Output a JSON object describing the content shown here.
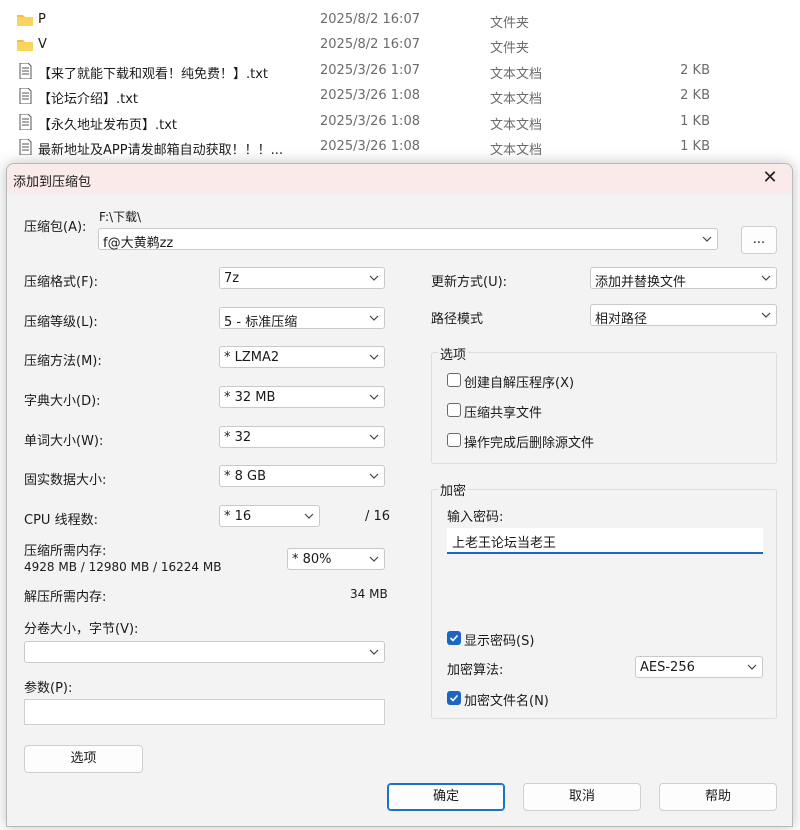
{
  "explorer": {
    "rows": [
      {
        "icon": "folder-icon",
        "name": "P",
        "date": "2025/8/2 16:07",
        "type": "文件夹",
        "size": ""
      },
      {
        "icon": "folder-icon",
        "name": "V",
        "date": "2025/8/2 16:07",
        "type": "文件夹",
        "size": ""
      },
      {
        "icon": "text-file-icon",
        "name": "【来了就能下载和观看！纯免费！】.txt",
        "date": "2025/3/26 1:07",
        "type": "文本文档",
        "size": "2 KB"
      },
      {
        "icon": "text-file-icon",
        "name": "【论坛介绍】.txt",
        "date": "2025/3/26 1:08",
        "type": "文本文档",
        "size": "2 KB"
      },
      {
        "icon": "text-file-icon",
        "name": "【永久地址发布页】.txt",
        "date": "2025/3/26 1:08",
        "type": "文本文档",
        "size": "1 KB"
      },
      {
        "icon": "text-file-icon",
        "name": "最新地址及APP请发邮箱自动获取！！！...",
        "date": "2025/3/26 1:08",
        "type": "文本文档",
        "size": "1 KB"
      }
    ]
  },
  "dialog": {
    "title": "添加到压缩包",
    "close_glyph": "✕",
    "archive": {
      "label": "压缩包(A):",
      "path": "F:\\下载\\",
      "name": "f@大黄鹈zz",
      "browse_label": "..."
    },
    "left": {
      "format": {
        "label": "压缩格式(F):",
        "value": "7z"
      },
      "level": {
        "label": "压缩等级(L):",
        "value": "5 - 标准压缩"
      },
      "method": {
        "label": "压缩方法(M):",
        "value": "* LZMA2"
      },
      "dict": {
        "label": "字典大小(D):",
        "value": "* 32 MB"
      },
      "word": {
        "label": "单词大小(W):",
        "value": "* 32"
      },
      "solid": {
        "label": "固实数据大小:",
        "value": "* 8 GB"
      },
      "threads": {
        "label": "CPU 线程数:",
        "value": "* 16",
        "max": "/ 16"
      },
      "mem_compress": {
        "label": "压缩所需内存:",
        "detail": "4928 MB / 12980 MB / 16224 MB",
        "value": "* 80%"
      },
      "mem_decompress": {
        "label": "解压所需内存:",
        "value": "34 MB"
      },
      "volume": {
        "label": "分卷大小，字节(V):",
        "value": ""
      },
      "params": {
        "label": "参数(P):",
        "value": ""
      },
      "options_button": "选项"
    },
    "right": {
      "update": {
        "label": "更新方式(U):",
        "value": "添加并替换文件"
      },
      "path_mode": {
        "label": "路径模式",
        "value": "相对路径"
      },
      "options_group": {
        "title": "选项",
        "items": [
          {
            "label": "创建自解压程序(X)",
            "checked": false
          },
          {
            "label": "压缩共享文件",
            "checked": false
          },
          {
            "label": "操作完成后删除源文件",
            "checked": false
          }
        ]
      },
      "encryption": {
        "title": "加密",
        "password_label": "输入密码:",
        "password_value": "上老王论坛当老王",
        "show_password": {
          "label": "显示密码(S)",
          "checked": true
        },
        "algorithm": {
          "label": "加密算法:",
          "value": "AES-256"
        },
        "encrypt_names": {
          "label": "加密文件名(N)",
          "checked": true
        }
      }
    },
    "buttons": {
      "ok": "确定",
      "cancel": "取消",
      "help": "帮助"
    }
  },
  "colors": {
    "accent": "#1a66c2",
    "titlebar": "#fbeaea",
    "dialog_bg": "#f3f3f3"
  }
}
